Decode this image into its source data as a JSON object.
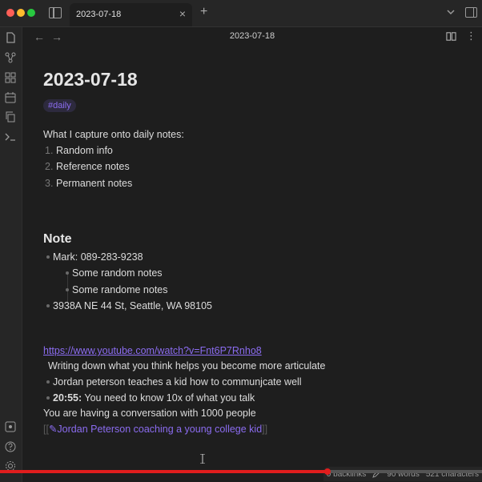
{
  "tab": {
    "title": "2023-07-18",
    "close": "×",
    "new": "+"
  },
  "nav": {
    "back": "←",
    "forward": "→",
    "more": "⋮"
  },
  "view": {
    "title": "2023-07-18"
  },
  "note": {
    "title": "2023-07-18",
    "tag": "#daily",
    "intro": "What I capture onto daily notes:",
    "list": [
      {
        "n": "1.",
        "text": "Random info"
      },
      {
        "n": "2.",
        "text": "Reference notes"
      },
      {
        "n": "3.",
        "text": "Permanent notes"
      }
    ],
    "heading": "Note",
    "bullets": {
      "mark": "Mark: 089-283-9238",
      "sub1": "Some random notes",
      "sub2": "Some randome notes",
      "address": "3938A NE 44 St, Seattle, WA 98105"
    },
    "link": "https://www.youtube.com/watch?v=Fnt6P7Rnho8",
    "line_writing": "Writing down what you think helps you become more articulate",
    "line_jordan": "Jordan peterson teaches a kid how to communjcate well",
    "time_label": "20:55:",
    "time_text": " You need to know 10x of what you talk",
    "line_conv": "You are having a conversation with 1000 people",
    "wiki_open": "[[",
    "wiki_text": "✎Jordan Peterson coaching a young college kid",
    "wiki_close": "]]"
  },
  "status": {
    "backlinks": "0 backlinks",
    "words": "90 words",
    "chars": "521 characters"
  },
  "progress": {
    "fraction": 0.68
  },
  "colors": {
    "accent": "#8b6cf0",
    "progress": "#e01d1d",
    "bg": "#1e1e1e"
  }
}
